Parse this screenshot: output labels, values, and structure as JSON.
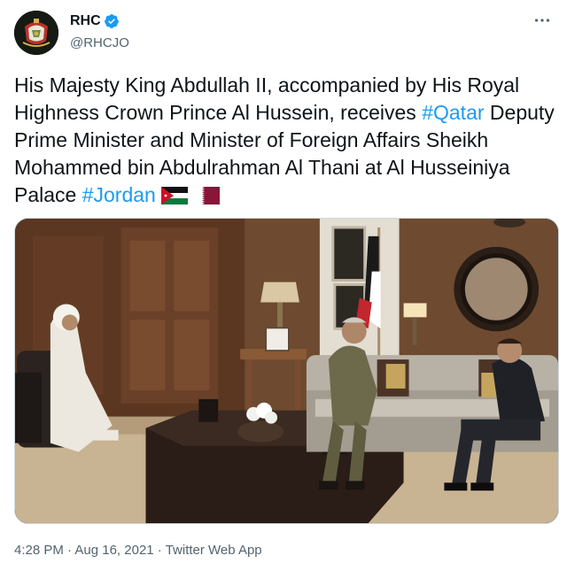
{
  "author": {
    "display_name": "RHC",
    "handle": "@RHCJO",
    "verified": true,
    "avatar_icon": "royal-coat-of-arms"
  },
  "more_icon": "ellipsis-icon",
  "tweet": {
    "text_part1": "His Majesty King Abdullah II, accompanied by His Royal Highness Crown Prince Al Hussein, receives ",
    "hashtag1": "#Qatar",
    "text_part2": " Deputy Prime Minister and Minister of Foreign Affairs Sheikh Mohammed bin Abdulrahman Al Thani at Al Husseiniya Palace ",
    "hashtag2": "#Jordan",
    "emoji_flags": [
      "jordan-flag",
      "qatar-flag"
    ]
  },
  "photo": {
    "alt_icon": "meeting-photo"
  },
  "meta": {
    "time": "4:28 PM",
    "separator": " · ",
    "date": "Aug 16, 2021",
    "source": "Twitter Web App"
  },
  "colors": {
    "link": "#1d9bf0",
    "secondary_text": "#536471",
    "primary_text": "#0f1419",
    "verified": "#1d9bf0"
  }
}
